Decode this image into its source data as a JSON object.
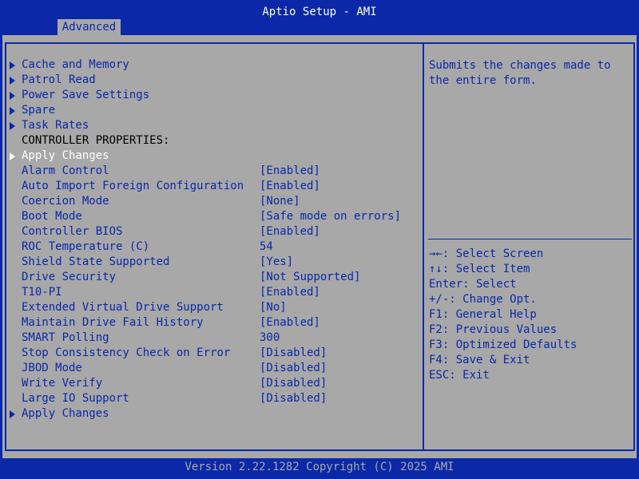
{
  "window": {
    "title": "Aptio Setup - AMI"
  },
  "tabs": [
    {
      "label": "Advanced",
      "active": true
    }
  ],
  "menu": {
    "items": [
      {
        "label": "Cache and Memory",
        "submenu": true
      },
      {
        "label": "Patrol Read",
        "submenu": true
      },
      {
        "label": "Power Save Settings",
        "submenu": true
      },
      {
        "label": "Spare",
        "submenu": true
      },
      {
        "label": "Task Rates",
        "submenu": true
      },
      {
        "label": "CONTROLLER PROPERTIES:",
        "header": true
      },
      {
        "label": "Apply Changes",
        "submenu": true,
        "selected": true
      },
      {
        "label": "Alarm Control",
        "value": "[Enabled]"
      },
      {
        "label": "Auto Import Foreign Configuration",
        "value": "[Enabled]"
      },
      {
        "label": "Coercion Mode",
        "value": "[None]"
      },
      {
        "label": "Boot Mode",
        "value": "[Safe mode on errors]"
      },
      {
        "label": "Controller BIOS",
        "value": "[Enabled]"
      },
      {
        "label": "ROC Temperature (C)",
        "value": "54"
      },
      {
        "label": "Shield State Supported",
        "value": "[Yes]"
      },
      {
        "label": "Drive Security",
        "value": "[Not Supported]"
      },
      {
        "label": "T10-PI",
        "value": "[Enabled]"
      },
      {
        "label": "Extended Virtual Drive Support",
        "value": "[No]"
      },
      {
        "label": "Maintain Drive Fail History",
        "value": "[Enabled]"
      },
      {
        "label": "SMART Polling",
        "value": "300"
      },
      {
        "label": "Stop Consistency Check on Error",
        "value": "[Disabled]"
      },
      {
        "label": "JBOD Mode",
        "value": "[Disabled]"
      },
      {
        "label": "Write Verify",
        "value": "[Disabled]"
      },
      {
        "label": "Large IO Support",
        "value": "[Disabled]"
      },
      {
        "label": "Apply Changes",
        "submenu": true
      }
    ]
  },
  "help": {
    "text": "Submits the changes made to\nthe entire form.",
    "keys": [
      "→←: Select Screen",
      "↑↓: Select Item",
      "Enter: Select",
      "+/-: Change Opt.",
      "F1: General Help",
      "F2: Previous Values",
      "F3: Optimized Defaults",
      "F4: Save & Exit",
      "ESC: Exit"
    ]
  },
  "footer": {
    "text": "Version 2.22.1282 Copyright (C) 2025 AMI"
  },
  "colors": {
    "background": "#0a28a8",
    "panel": "#a8a8a8",
    "text": "#0a28a8",
    "selected_text": "#ffffff"
  }
}
